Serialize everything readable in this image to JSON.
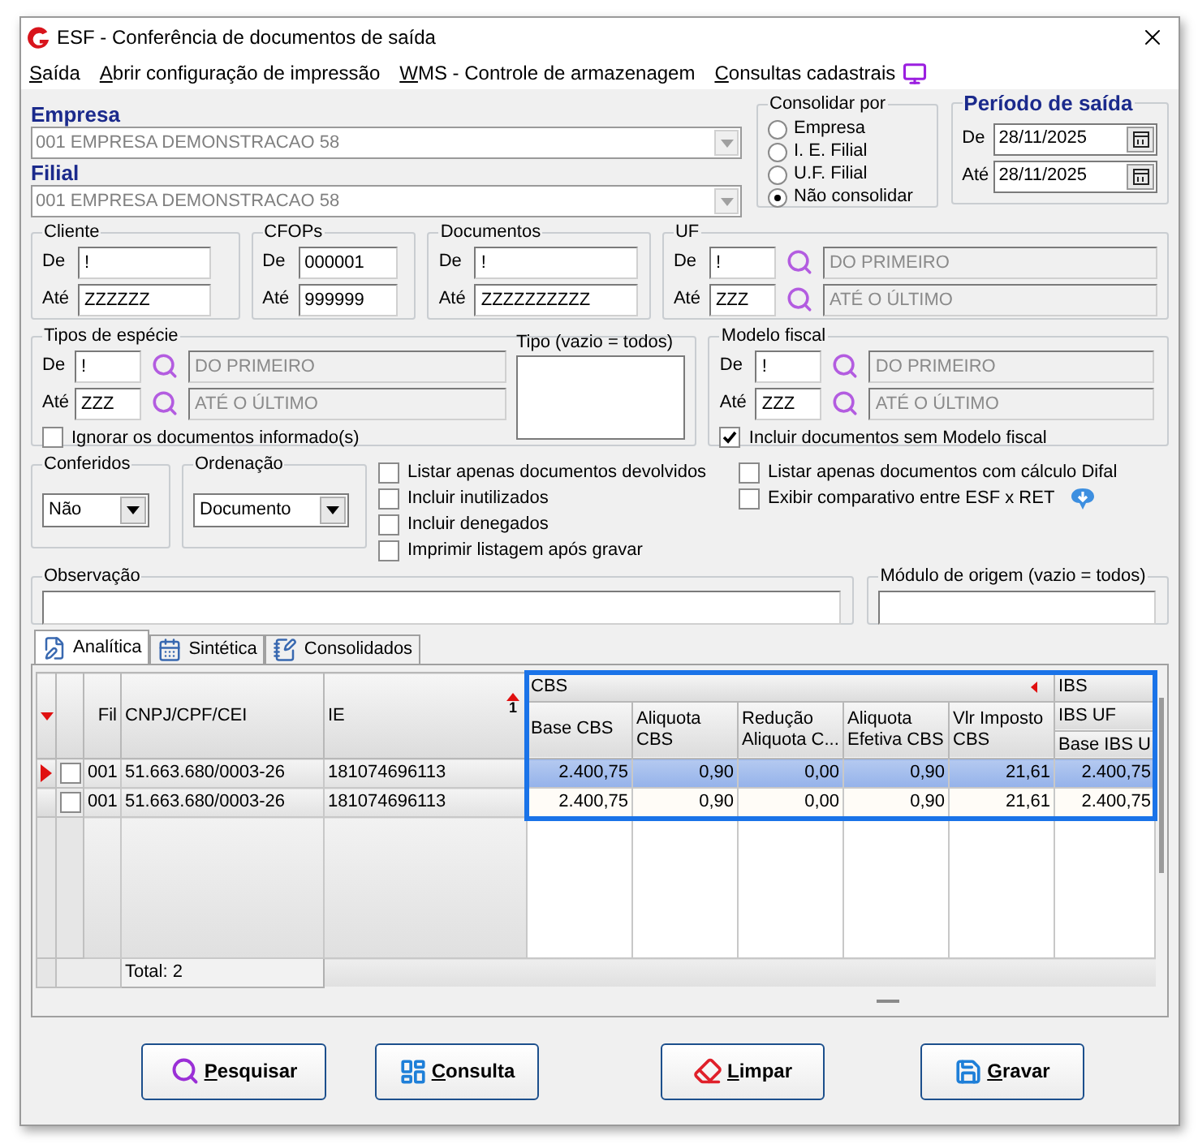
{
  "window": {
    "title": "ESF - Conferência de documentos de saída"
  },
  "menu": [
    {
      "label": "Saída"
    },
    {
      "label": "Abrir configuração de impressão"
    },
    {
      "label": "WMS - Controle de armazenagem"
    },
    {
      "label": "Consultas cadastrais"
    }
  ],
  "empresa": {
    "label": "Empresa",
    "value": "001 EMPRESA DEMONSTRACAO 58"
  },
  "filial": {
    "label": "Filial",
    "value": "001 EMPRESA DEMONSTRACAO 58"
  },
  "consolidar": {
    "title": "Consolidar por",
    "options": [
      {
        "label": "Empresa",
        "selected": false
      },
      {
        "label": "I. E. Filial",
        "selected": false
      },
      {
        "label": "U.F. Filial",
        "selected": false
      },
      {
        "label": "Não consolidar",
        "selected": true
      }
    ]
  },
  "periodo": {
    "title": "Período de saída",
    "rows": [
      {
        "label": "De",
        "value": "28/11/2025"
      },
      {
        "label": "Até",
        "value": "28/11/2025"
      }
    ]
  },
  "cliente": {
    "title": "Cliente",
    "rows": [
      {
        "label": "De",
        "value": "!"
      },
      {
        "label": "Até",
        "value": "ZZZZZZ"
      }
    ]
  },
  "cfops": {
    "title": "CFOPs",
    "rows": [
      {
        "label": "De",
        "value": "000001"
      },
      {
        "label": "Até",
        "value": "999999"
      }
    ]
  },
  "documentos": {
    "title": "Documentos",
    "rows": [
      {
        "label": "De",
        "value": "!"
      },
      {
        "label": "Até",
        "value": "ZZZZZZZZZZ"
      }
    ]
  },
  "uf": {
    "title": "UF",
    "rows": [
      {
        "label": "De",
        "value": "!",
        "description": "DO PRIMEIRO"
      },
      {
        "label": "Até",
        "value": "ZZZ",
        "description": "ATÉ O ÚLTIMO"
      }
    ]
  },
  "tipos_especie": {
    "title": "Tipos de espécie",
    "rows": [
      {
        "label": "De",
        "value": "!",
        "description": "DO PRIMEIRO"
      },
      {
        "label": "Até",
        "value": "ZZZ",
        "description": "ATÉ O ÚLTIMO"
      }
    ],
    "checkbox": {
      "label": "Ignorar os documentos informado(s)",
      "checked": false
    }
  },
  "tipo": {
    "title": "Tipo (vazio = todos)"
  },
  "modelo_fiscal": {
    "title": "Modelo fiscal",
    "rows": [
      {
        "label": "De",
        "value": "!",
        "description": "DO PRIMEIRO"
      },
      {
        "label": "Até",
        "value": "ZZZ",
        "description": "ATÉ O ÚLTIMO"
      }
    ],
    "checkbox": {
      "label": "Incluir documentos sem Modelo fiscal",
      "checked": true
    }
  },
  "conferidos": {
    "title": "Conferidos",
    "value": "Não"
  },
  "ordenacao": {
    "title": "Ordenação",
    "value": "Documento"
  },
  "options_left": [
    {
      "label": "Listar apenas documentos devolvidos",
      "checked": false
    },
    {
      "label": "Incluir inutilizados",
      "checked": false
    },
    {
      "label": "Incluir denegados",
      "checked": false
    },
    {
      "label": "Imprimir listagem após gravar",
      "checked": false
    }
  ],
  "options_right": [
    {
      "label": "Listar apenas documentos com cálculo Difal",
      "checked": false,
      "info": false
    },
    {
      "label": "Exibir comparativo entre ESF x  RET",
      "checked": false,
      "info": true
    }
  ],
  "observacao": {
    "title": "Observação"
  },
  "modulo": {
    "title": "Módulo de origem (vazio = todos)"
  },
  "tabs": [
    {
      "label": "Analítica",
      "selected": true
    },
    {
      "label": "Sintética",
      "selected": false
    },
    {
      "label": "Consolidados",
      "selected": false
    }
  ],
  "grid": {
    "columns_left": [
      {
        "label": "Fil"
      },
      {
        "label": "CNPJ/CPF/CEI"
      },
      {
        "label": "IE",
        "sort_rank": "1"
      }
    ],
    "bands": [
      {
        "label": "CBS",
        "columns": [
          "Base CBS",
          "Aliquota CBS",
          "Redução Aliquota C...",
          "Aliquota Efetiva CBS",
          "Vlr Imposto CBS"
        ]
      },
      {
        "label": "IBS",
        "subband": "IBS UF",
        "columns": [
          "Base IBS U"
        ]
      }
    ],
    "rows": [
      {
        "selected": true,
        "checked": false,
        "cells": [
          "001",
          "51.663.680/0003-26",
          "181074696113",
          "2.400,75",
          "0,90",
          "0,00",
          "0,90",
          "21,61",
          "2.400,75"
        ]
      },
      {
        "selected": false,
        "checked": false,
        "cells": [
          "001",
          "51.663.680/0003-26",
          "181074696113",
          "2.400,75",
          "0,90",
          "0,00",
          "0,90",
          "21,61",
          "2.400,75"
        ]
      }
    ],
    "total": "Total: 2"
  },
  "buttons": [
    {
      "label": "Pesquisar",
      "kind": "search"
    },
    {
      "label": "Consulta",
      "kind": "query"
    },
    {
      "label": "Limpar",
      "kind": "clear"
    },
    {
      "label": "Gravar",
      "kind": "save"
    }
  ]
}
